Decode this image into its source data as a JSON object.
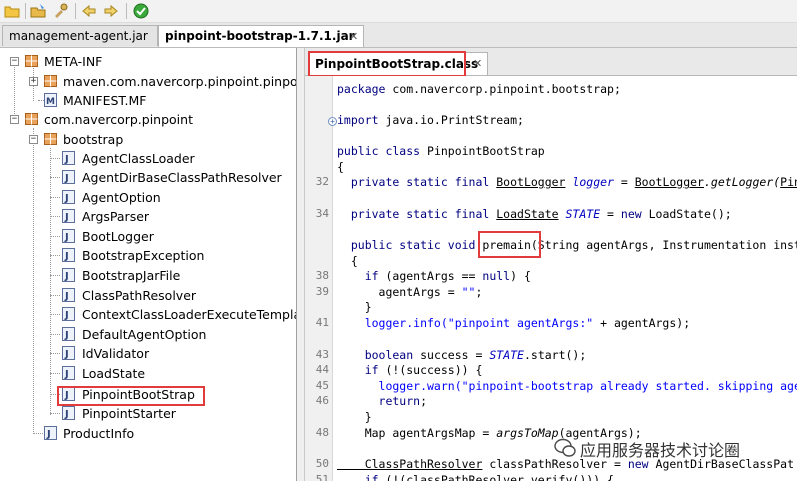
{
  "top_tabs": [
    {
      "label": "management-agent.jar",
      "active": false
    },
    {
      "label": "pinpoint-bootstrap-1.7.1.jar",
      "active": true
    }
  ],
  "editor_tab": {
    "label": "PinpointBootStrap.class"
  },
  "tree": [
    {
      "label": "META-INF"
    },
    {
      "label": "maven.com.navercorp.pinpoint.pinpoint-"
    },
    {
      "label": "MANIFEST.MF"
    },
    {
      "label": "com.navercorp.pinpoint"
    },
    {
      "label": "bootstrap"
    },
    {
      "label": "AgentClassLoader"
    },
    {
      "label": "AgentDirBaseClassPathResolver"
    },
    {
      "label": "AgentOption"
    },
    {
      "label": "ArgsParser"
    },
    {
      "label": "BootLogger"
    },
    {
      "label": "BootstrapException"
    },
    {
      "label": "BootstrapJarFile"
    },
    {
      "label": "ClassPathResolver"
    },
    {
      "label": "ContextClassLoaderExecuteTemplate"
    },
    {
      "label": "DefaultAgentOption"
    },
    {
      "label": "IdValidator"
    },
    {
      "label": "LoadState"
    },
    {
      "label": "PinpointBootStrap"
    },
    {
      "label": "PinpointStarter"
    },
    {
      "label": "ProductInfo"
    }
  ],
  "code": {
    "package_kw": "package",
    "package_name": " com.navercorp.pinpoint.bootstrap;",
    "import_kw": "import",
    "import_name": " java.io.PrintStream;",
    "class_decl_kw": "public class",
    "class_name": " PinpointBootStrap",
    "open_brace": "{",
    "l32_kw": "  private static final ",
    "l32_type": "BootLogger",
    "l32_var": " logger",
    "l32_eq": " = ",
    "l32_cls": "BootLogger",
    "l32_call": ".getLogger(",
    "l32_tail": "Pin",
    "l34_kw": "  private static final ",
    "l34_type": "LoadState",
    "l34_sp": " ",
    "l34_var": "STATE",
    "l34_eq": " = ",
    "l34_new": "new",
    "l34_rest": " LoadState();",
    "main_kw": "  public static void ",
    "main_name": "premain",
    "main_rest": "(String agentArgs, Instrumentation inst",
    "brace2": "  {",
    "l38_kw": "    if",
    "l38_a": " (agentArgs == ",
    "l38_null": "null",
    "l38_b": ") {",
    "l39_a": "      agentArgs = ",
    "l39_str": "\"\"",
    "l39_b": ";",
    "close1": "    }",
    "l41_call": "    logger.info(",
    "l41_str": "\"pinpoint agentArgs:\"",
    "l41_b": " + agentArgs);",
    "l43_kw": "    boolean",
    "l43_a": " success = ",
    "l43_fld": "STATE",
    "l43_b": ".start();",
    "l44_kw": "    if",
    "l44_a": " (!(success)) {",
    "l45_call": "      logger.warn(",
    "l45_str": "\"pinpoint-bootstrap already started. skipping age",
    "l46_kw": "      return",
    "l46_b": ";",
    "close2": "    }",
    "l48_a": "    Map agentArgsMap = ",
    "l48_it": "argsToMap",
    "l48_b": "(agentArgs);",
    "l50_type": "    ClassPathResolver",
    "l50_a": " classPathResolver = ",
    "l50_new": "new",
    "l50_b": " AgentDirBaseClassPat",
    "l51_kw": "    if",
    "l51_a": " (!(classPathResolver.verify())) {"
  },
  "line_numbers": [
    "32",
    "34",
    "38",
    "39",
    "41",
    "43",
    "44",
    "45",
    "46",
    "48",
    "50",
    "51"
  ],
  "watermark": {
    "text": "应用服务器技术讨论圈"
  },
  "colors": {
    "highlight": "#e23b3b",
    "keyword": "#000080",
    "string": "#0000ff"
  }
}
